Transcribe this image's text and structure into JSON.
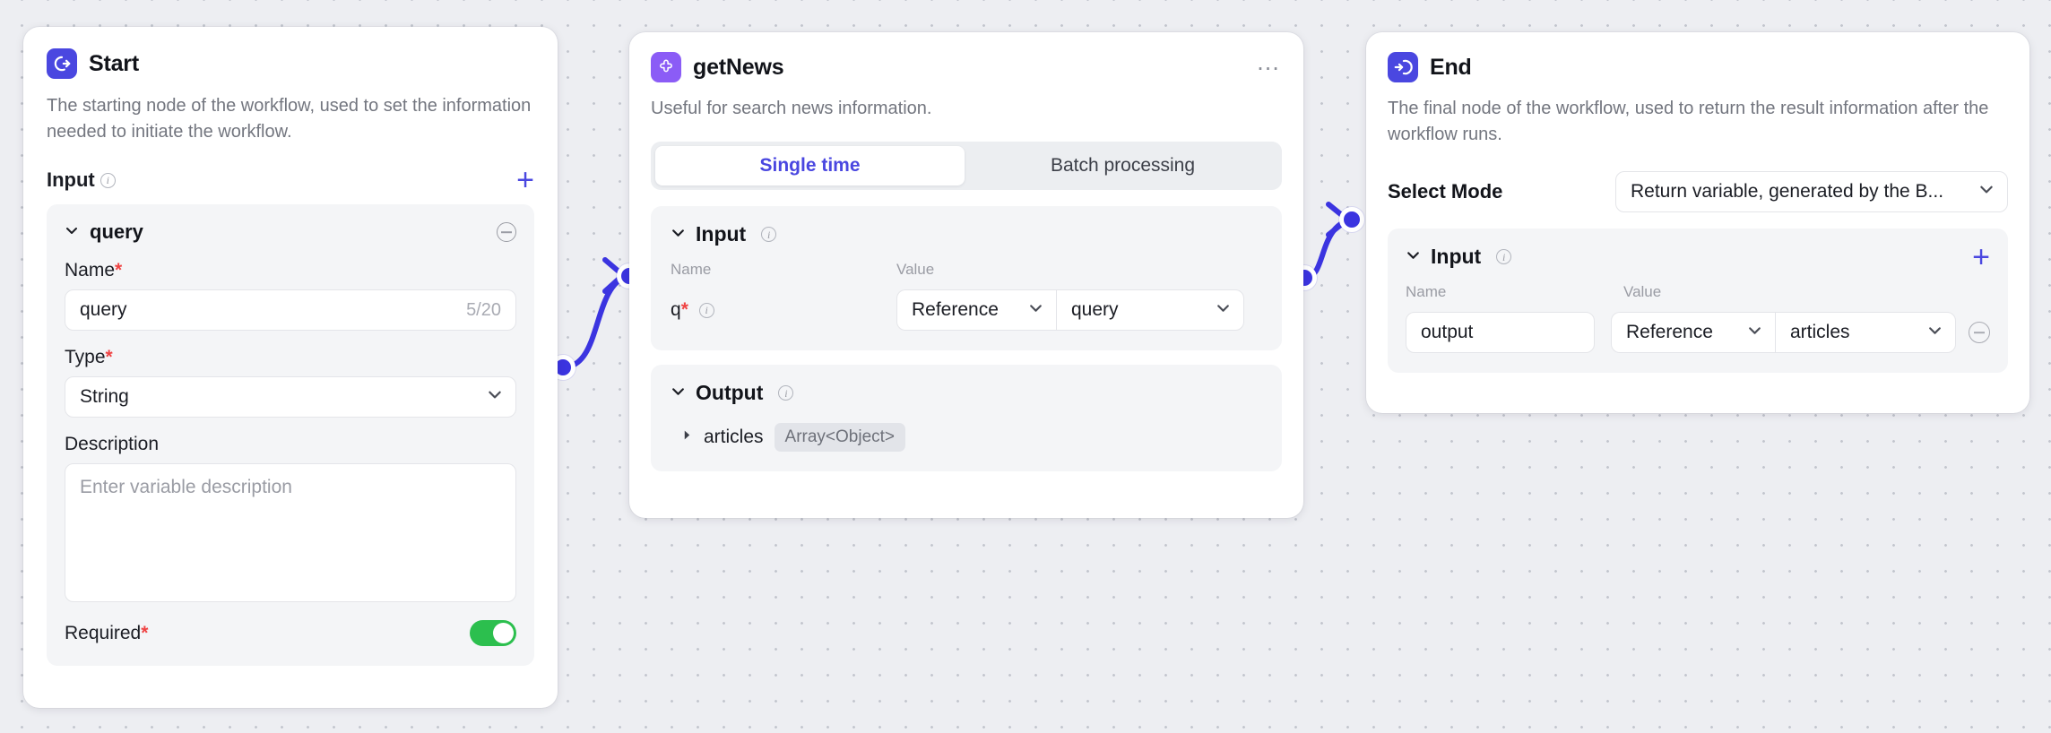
{
  "canvas": {
    "background_color": "#edeef2",
    "accent_color": "#4a47e0",
    "toggle_on_color": "#2cbf4e"
  },
  "nodes": {
    "start": {
      "title": "Start",
      "icon": "start-circle-arrow-icon",
      "description": "The starting node of the workflow, used to set the information needed to initiate the workflow.",
      "input_section": {
        "label": "Input",
        "add_label": "+"
      },
      "variable": {
        "name": "query",
        "name_label": "Name",
        "name_value": "query",
        "name_counter": "5/20",
        "type_label": "Type",
        "type_value": "String",
        "description_label": "Description",
        "description_placeholder": "Enter variable description",
        "required_label": "Required",
        "required_on": true
      }
    },
    "getnews": {
      "title": "getNews",
      "icon": "plugin-puzzle-icon",
      "description": "Useful for search news information.",
      "menu": "…",
      "tabs": [
        {
          "label": "Single time",
          "active": true
        },
        {
          "label": "Batch processing",
          "active": false
        }
      ],
      "input_section": {
        "label": "Input",
        "col_name": "Name",
        "col_value": "Value",
        "rows": [
          {
            "name": "q",
            "required": true,
            "value_type": "Reference",
            "value": "query"
          }
        ]
      },
      "output_section": {
        "label": "Output",
        "rows": [
          {
            "name": "articles",
            "type": "Array<Object>"
          }
        ]
      }
    },
    "end": {
      "title": "End",
      "icon": "end-arrow-into-circle-icon",
      "description": "The final node of the workflow, used to return the result information after the workflow runs.",
      "select_mode_label": "Select Mode",
      "select_mode_value": "Return variable, generated by the B...",
      "input_section": {
        "label": "Input",
        "add_label": "+",
        "col_name": "Name",
        "col_value": "Value",
        "rows": [
          {
            "name": "output",
            "value_type": "Reference",
            "value": "articles"
          }
        ]
      }
    }
  }
}
